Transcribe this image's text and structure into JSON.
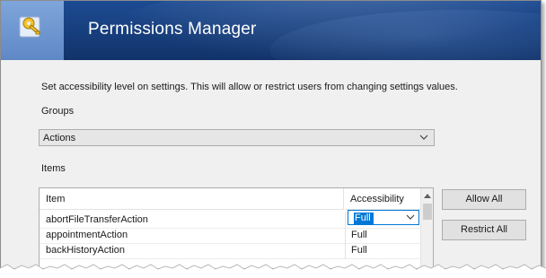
{
  "window": {
    "title": "Permissions Manager",
    "icon": "keys-icon"
  },
  "description": "Set accessibility level  on settings.  This will allow or restrict users from changing settings values.",
  "groups": {
    "label": "Groups",
    "selected": "Actions"
  },
  "items": {
    "label": "Items",
    "columns": [
      "Item",
      "Accessibility"
    ],
    "rows": [
      {
        "name": "abortFileTransferAction",
        "accessibility": "Full"
      },
      {
        "name": "appointmentAction",
        "accessibility": "Full"
      },
      {
        "name": "backHistoryAction",
        "accessibility": "Full"
      }
    ]
  },
  "buttons": {
    "allow_all": "Allow All",
    "restrict_all": "Restrict All"
  },
  "colors": {
    "banner": "#173e7c",
    "accent": "#0078d7",
    "icon_bg": "#6d95cf"
  }
}
